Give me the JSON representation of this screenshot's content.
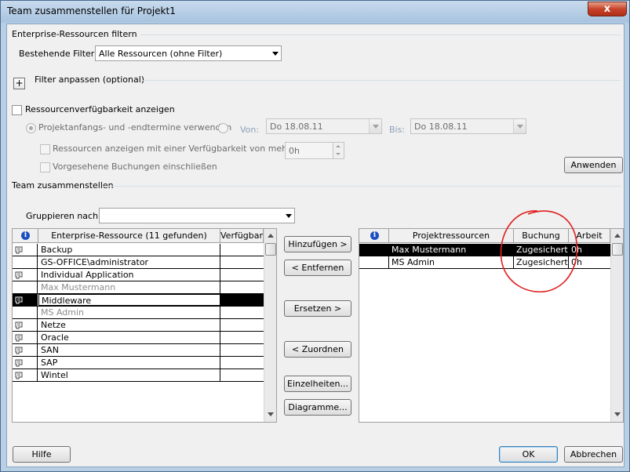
{
  "window": {
    "title": "Team zusammenstellen für Projekt1",
    "close_glyph": "x"
  },
  "filter": {
    "section_title": "Enterprise-Ressourcen filtern",
    "existing_label": "Bestehende Filter:",
    "existing_value": "Alle Ressourcen (ohne Filter)",
    "customize_label": "Filter anpassen (optional)",
    "plus_glyph": "+"
  },
  "availability": {
    "checkbox_label": "Ressourcenverfügbarkeit anzeigen",
    "radio_label": "Projektanfangs- und -endtermine verwenden",
    "from_label": "Von:",
    "from_value": "Do 18.08.11",
    "to_label": "Bis:",
    "to_value": "Do 18.08.11",
    "min_avail_label": "Ressourcen anzeigen mit einer Verfügbarkeit von mehr als:",
    "min_avail_value": "0h",
    "proposed_label": "Vorgesehene Buchungen einschließen",
    "apply_button": "Anwenden"
  },
  "team": {
    "section_title": "Team zusammenstellen",
    "group_label": "Gruppieren nach:",
    "group_value": ""
  },
  "enterprise_grid": {
    "info_glyph": "i",
    "columns": [
      "Enterprise-Ressource (11 gefunden)",
      "Verfügbar"
    ],
    "rows": [
      {
        "name": "Backup",
        "icon": "resource-icon",
        "grey": false,
        "selected": false
      },
      {
        "name": "GS-OFFICE\\administrator",
        "icon": "",
        "grey": false,
        "selected": false
      },
      {
        "name": "Individual Application",
        "icon": "resource-icon",
        "grey": false,
        "selected": false
      },
      {
        "name": "Max Mustermann",
        "icon": "",
        "grey": true,
        "selected": false
      },
      {
        "name": "Middleware",
        "icon": "resource-icon",
        "grey": false,
        "selected": true
      },
      {
        "name": "MS Admin",
        "icon": "",
        "grey": true,
        "selected": false
      },
      {
        "name": "Netze",
        "icon": "resource-icon",
        "grey": false,
        "selected": false
      },
      {
        "name": "Oracle",
        "icon": "resource-icon",
        "grey": false,
        "selected": false
      },
      {
        "name": "SAN",
        "icon": "resource-icon",
        "grey": false,
        "selected": false
      },
      {
        "name": "SAP",
        "icon": "resource-icon",
        "grey": false,
        "selected": false
      },
      {
        "name": "Wintel",
        "icon": "resource-icon",
        "grey": false,
        "selected": false
      }
    ]
  },
  "actions": {
    "add": "Hinzufügen >",
    "remove": "< Entfernen",
    "replace": "Ersetzen >",
    "assign": "< Zuordnen",
    "details": "Einzelheiten...",
    "graphs": "Diagramme..."
  },
  "project_grid": {
    "info_glyph": "i",
    "columns": [
      "Projektressourcen",
      "Buchung",
      "Arbeit"
    ],
    "rows": [
      {
        "name": "Max Mustermann",
        "booking": "Zugesichert",
        "work": "0h",
        "selected": true
      },
      {
        "name": "MS Admin",
        "booking": "Zugesichert",
        "work": "0h",
        "selected": false
      }
    ]
  },
  "footer": {
    "help": "Hilfe",
    "ok": "OK",
    "cancel": "Abbrechen"
  },
  "annotation_color": "#e02020"
}
